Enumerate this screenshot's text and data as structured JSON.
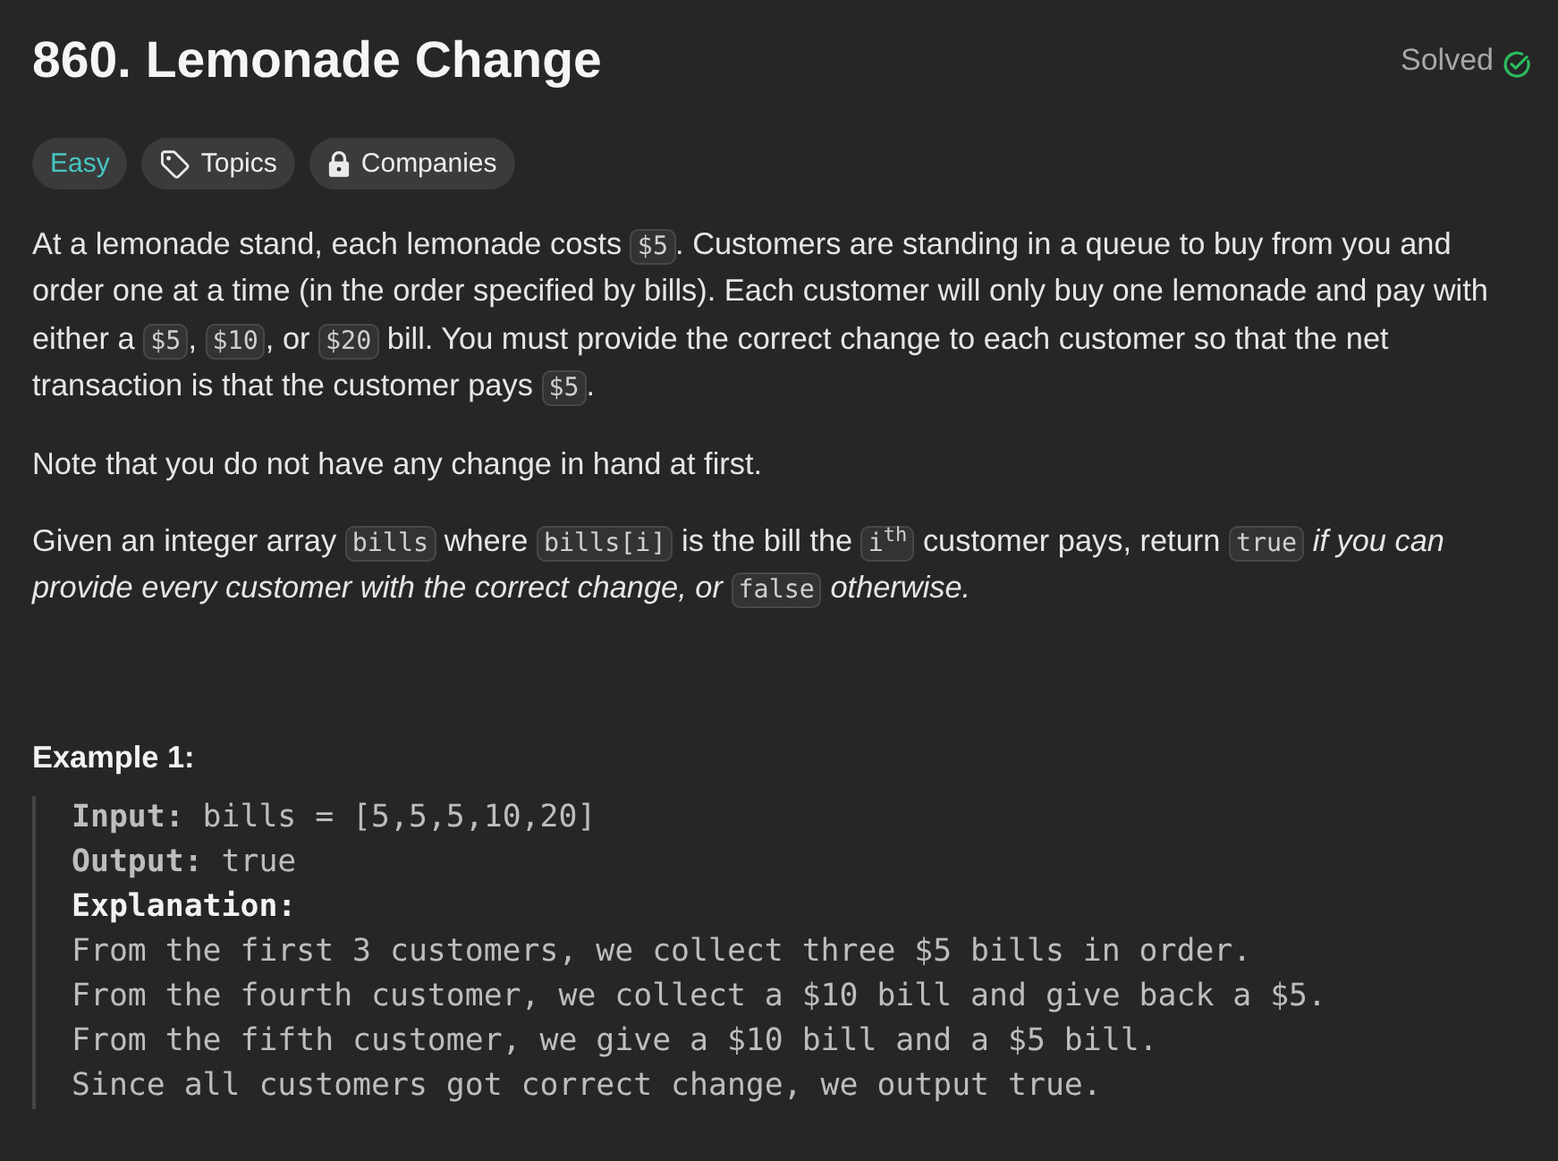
{
  "header": {
    "title": "860. Lemonade Change",
    "status": "Solved"
  },
  "tags": [
    {
      "kind": "difficulty",
      "label": "Easy"
    },
    {
      "kind": "topics",
      "label": "Topics"
    },
    {
      "kind": "companies",
      "label": "Companies"
    }
  ],
  "description": [
    [
      {
        "kind": "text",
        "text": "At a lemonade stand, each lemonade costs "
      },
      {
        "kind": "code",
        "text": "$5"
      },
      {
        "kind": "text",
        "text": ". Customers are standing in a queue to buy from you and order one at a time (in the order specified by bills). Each customer will only buy one lemonade and pay with either a "
      },
      {
        "kind": "code",
        "text": "$5"
      },
      {
        "kind": "text",
        "text": ", "
      },
      {
        "kind": "code",
        "text": "$10"
      },
      {
        "kind": "text",
        "text": ", or "
      },
      {
        "kind": "code",
        "text": "$20"
      },
      {
        "kind": "text",
        "text": " bill. You must provide the correct change to each customer so that the net transaction is that the customer pays "
      },
      {
        "kind": "code",
        "text": "$5"
      },
      {
        "kind": "text",
        "text": "."
      }
    ],
    [
      {
        "kind": "text",
        "text": "Note that you do not have any change in hand at first."
      }
    ],
    [
      {
        "kind": "text",
        "text": "Given an integer array "
      },
      {
        "kind": "code",
        "text": "bills"
      },
      {
        "kind": "text",
        "text": " where "
      },
      {
        "kind": "code",
        "text": "bills[i]"
      },
      {
        "kind": "text",
        "text": " is the bill the "
      },
      {
        "kind": "code",
        "text": "i$^{th}$"
      },
      {
        "kind": "text",
        "text": " customer pays, return "
      },
      {
        "kind": "code",
        "text": "true"
      },
      {
        "kind": "text",
        "text": " *if you can provide every customer with the correct change, or* "
      },
      {
        "kind": "code",
        "text": "false"
      },
      {
        "kind": "text",
        "text": " *otherwise.*"
      }
    ]
  ],
  "examples": [
    {
      "title": "Example 1:",
      "lines": [
        {
          "kind": "field",
          "text": "**Input:** bills = [5,5,5,10,20]"
        },
        {
          "kind": "field",
          "text": "**Output:** true"
        },
        {
          "kind": "heading",
          "text": "Explanation:"
        },
        {
          "kind": "plain",
          "text": "From the first 3 customers, we collect three $5 bills in order."
        },
        {
          "kind": "plain",
          "text": "From the fourth customer, we collect a $10 bill and give back a $5."
        },
        {
          "kind": "plain",
          "text": "From the fifth customer, we give a $10 bill and a $5 bill."
        },
        {
          "kind": "plain",
          "text": "Since all customers got correct change, we output true."
        }
      ]
    }
  ]
}
